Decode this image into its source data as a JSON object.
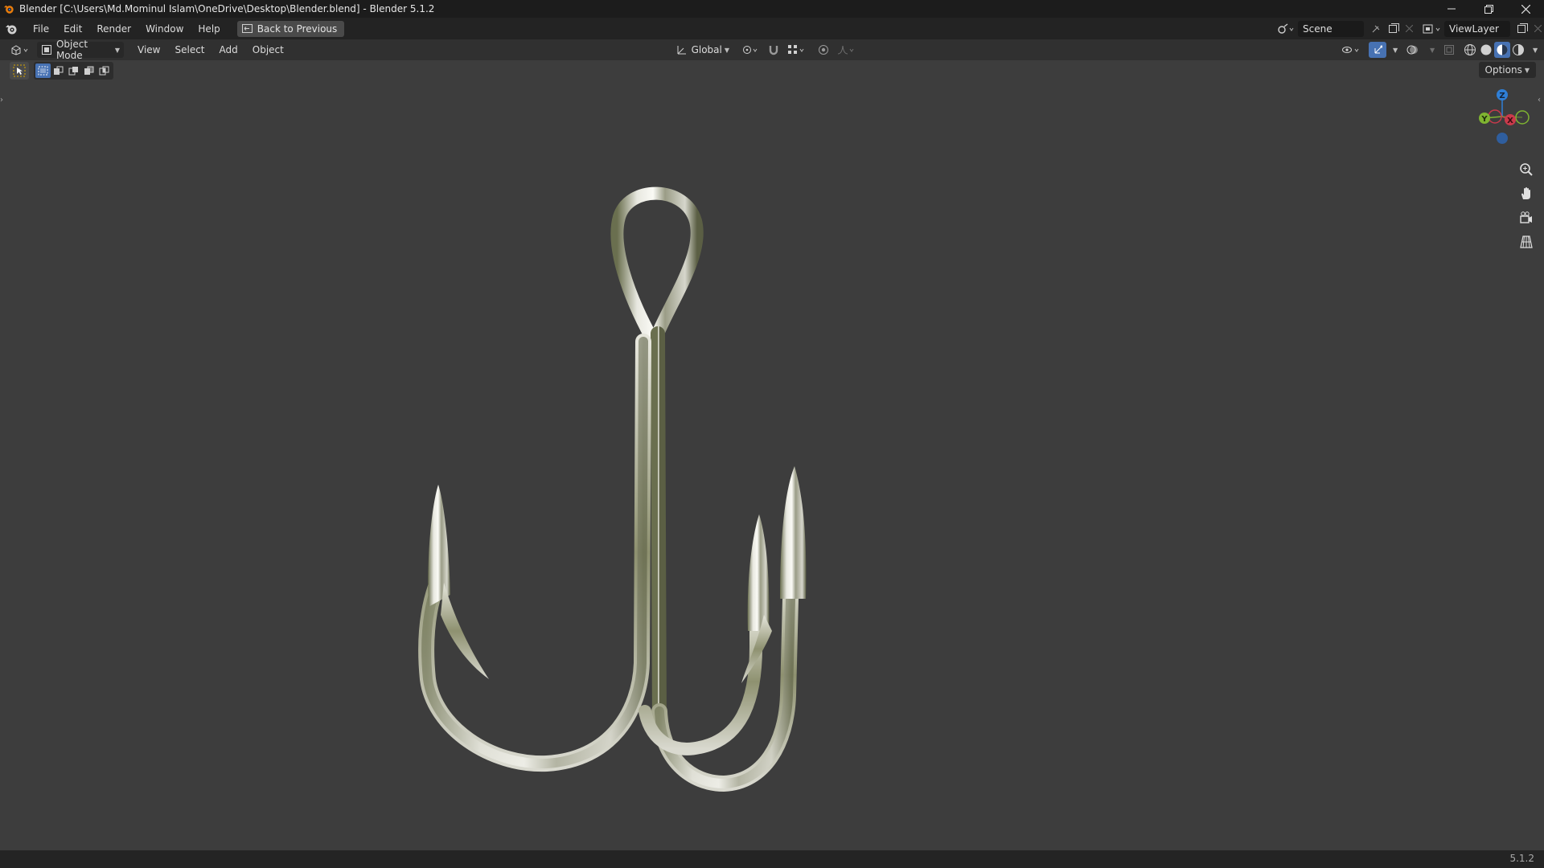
{
  "window": {
    "title": "Blender [C:\\Users\\Md.Mominul Islam\\OneDrive\\Desktop\\Blender.blend] - Blender 5.1.2",
    "controls": [
      "minimize",
      "restore",
      "close"
    ]
  },
  "menu": {
    "items": [
      "File",
      "Edit",
      "Render",
      "Window",
      "Help"
    ],
    "back_button": "Back to Previous"
  },
  "scene": {
    "name": "Scene"
  },
  "view_layer": {
    "name": "ViewLayer"
  },
  "header": {
    "mode": "Object Mode",
    "menus": [
      "View",
      "Select",
      "Add",
      "Object"
    ],
    "orientation": "Global"
  },
  "viewport": {
    "options_label": "Options",
    "gizmo_axes": [
      "Z",
      "Y",
      "X"
    ],
    "object": "fishing-hook-model"
  },
  "statusbar": {
    "version": "5.1.2"
  },
  "colors": {
    "accent": "#4772b3",
    "axis_x": "#c93a4b",
    "axis_y": "#7fb431",
    "axis_z": "#2f7fd6"
  }
}
